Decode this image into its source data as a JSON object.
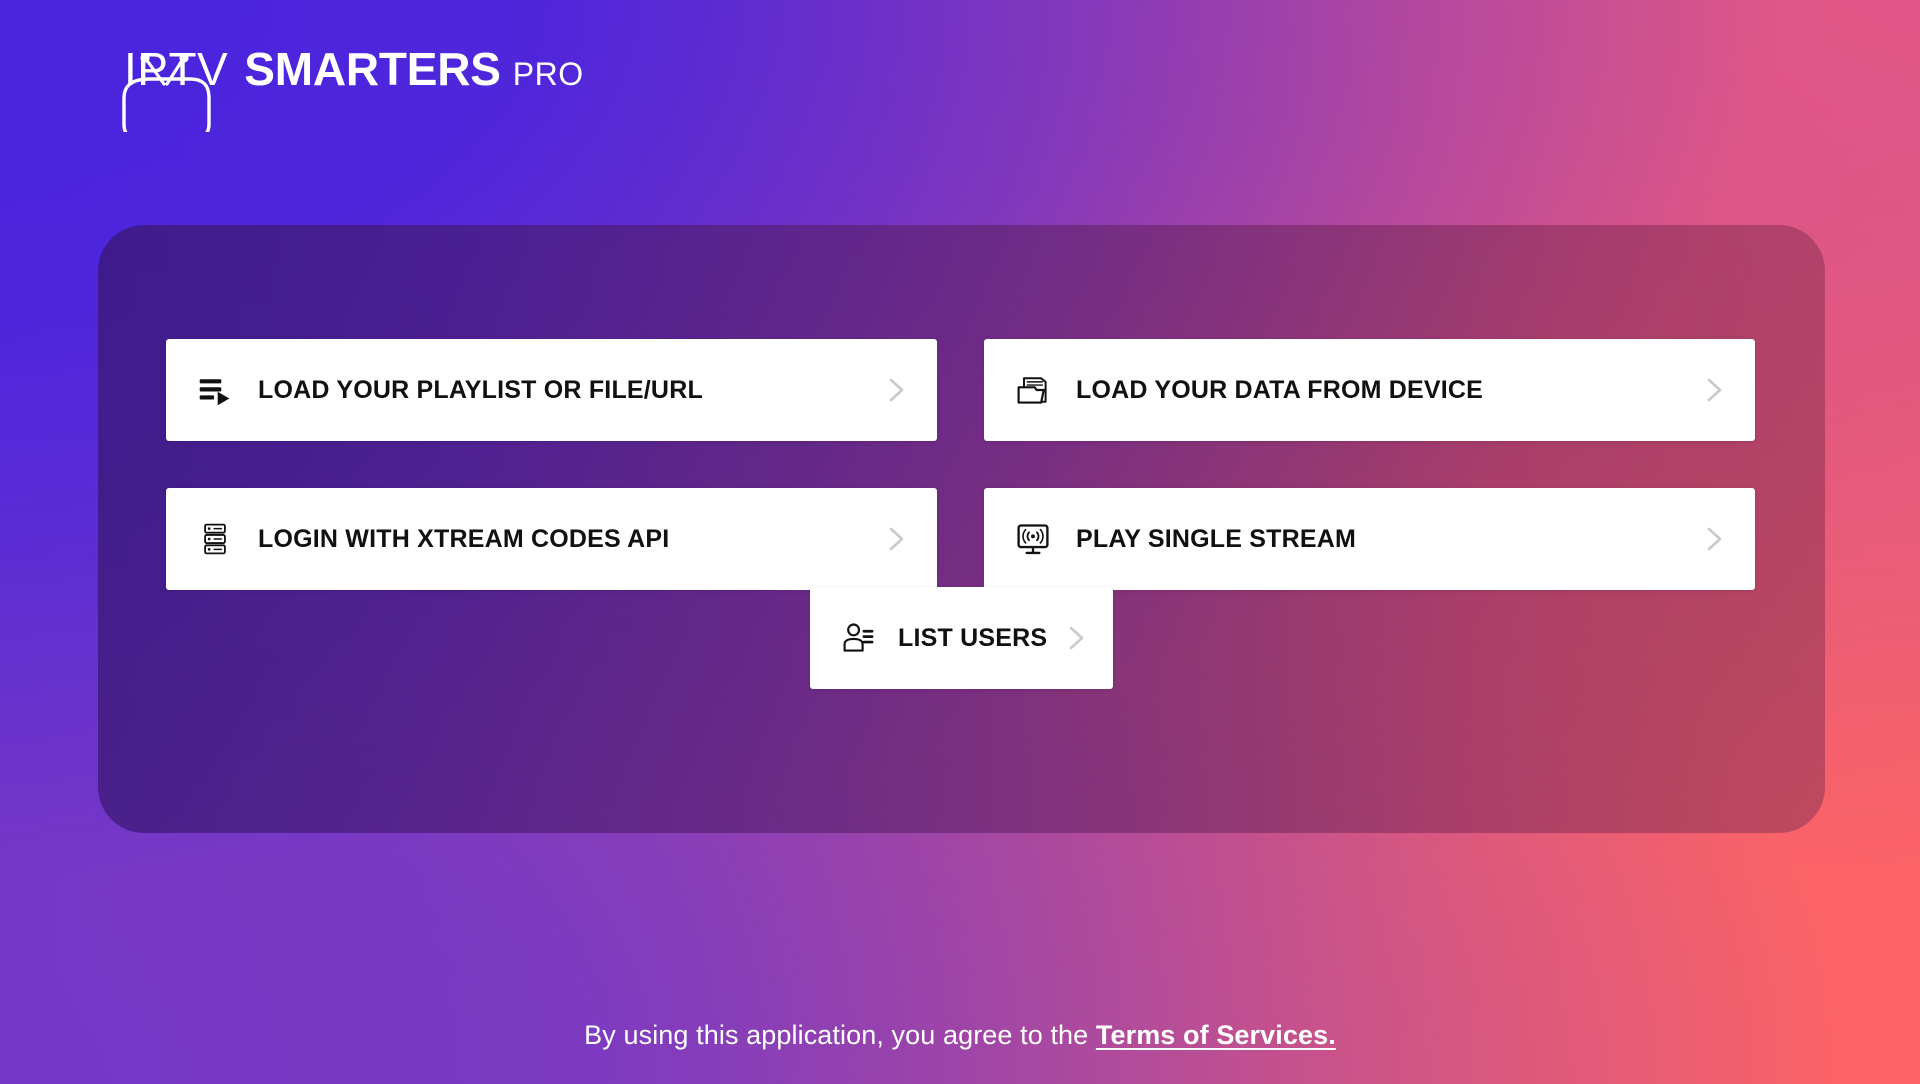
{
  "brand": {
    "name_light": "IPTV",
    "name_bold": "SMARTERS",
    "name_suffix": "PRO",
    "logo_icon": "tv-antenna-icon"
  },
  "theme": {
    "bg_top_left": "#4A24DE",
    "bg_top_right": "#DE5686",
    "bg_bottom_left": "#7538C6",
    "bg_bottom_right": "#FC6366",
    "card_left": "#441D82",
    "card_right": "#963A5C",
    "button_bg": "#FFFFFF",
    "button_text": "#111111",
    "chevron": "#C9C9C9",
    "footer_text": "#FFFFFF"
  },
  "menu": {
    "buttons": [
      {
        "id": "load-playlist",
        "label": "LOAD YOUR PLAYLIST OR FILE/URL",
        "icon": "playlist-play-icon",
        "chevron": "chevron-right-icon"
      },
      {
        "id": "load-device",
        "label": "LOAD YOUR DATA FROM DEVICE",
        "icon": "folder-file-icon",
        "chevron": "chevron-right-icon"
      },
      {
        "id": "xtream-login",
        "label": "LOGIN WITH XTREAM CODES API",
        "icon": "server-rack-icon",
        "chevron": "chevron-right-icon"
      },
      {
        "id": "single-stream",
        "label": "PLAY SINGLE STREAM",
        "icon": "monitor-signal-icon",
        "chevron": "chevron-right-icon"
      }
    ],
    "center_button": {
      "id": "list-users",
      "label": "LIST USERS",
      "icon": "user-list-icon",
      "chevron": "chevron-right-icon"
    }
  },
  "footer": {
    "text_before": "By using this application, you agree to the ",
    "link_label": "Terms of Services."
  }
}
